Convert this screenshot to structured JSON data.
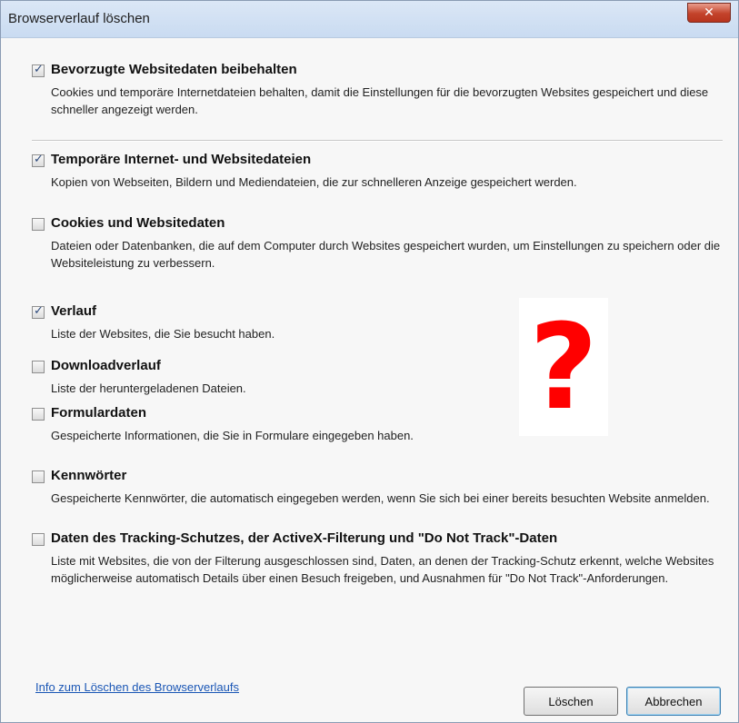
{
  "window": {
    "title": "Browserverlauf löschen",
    "close_icon": "close-icon",
    "close_glyph": "✕"
  },
  "options": [
    {
      "title": "Bevorzugte Websitedaten beibehalten",
      "desc": "Cookies und temporäre Internetdateien behalten, damit die Einstellungen für die bevorzugten Websites gespeichert und diese schneller angezeigt werden.",
      "checked": true
    },
    {
      "title": "Temporäre Internet- und Websitedateien",
      "desc": "Kopien von Webseiten, Bildern und Mediendateien, die zur schnelleren Anzeige gespeichert werden.",
      "checked": true
    },
    {
      "title": "Cookies und Websitedaten",
      "desc": "Dateien oder Datenbanken, die auf dem Computer durch Websites gespeichert wurden, um Einstellungen zu speichern oder die Websiteleistung zu verbessern.",
      "checked": false
    },
    {
      "title": "Verlauf",
      "desc": "Liste der Websites, die Sie besucht haben.",
      "checked": true
    },
    {
      "title": "Downloadverlauf",
      "desc": "Liste der heruntergeladenen Dateien.",
      "checked": false
    },
    {
      "title": "Formulardaten",
      "desc": "Gespeicherte Informationen, die Sie in Formulare eingegeben haben.",
      "checked": false
    },
    {
      "title": "Kennwörter",
      "desc": "Gespeicherte Kennwörter, die automatisch eingegeben werden, wenn Sie sich bei einer bereits besuchten Website anmelden.",
      "checked": false
    },
    {
      "title": "Daten des Tracking-Schutzes, der ActiveX-Filterung und \"Do Not Track\"-Daten",
      "desc": "Liste mit Websites, die von der Filterung ausgeschlossen sind, Daten, an denen der Tracking-Schutz erkennt, welche Websites möglicherweise automatisch Details über einen Besuch freigeben, und Ausnahmen für \"Do Not Track\"-Anforderungen.",
      "checked": false
    }
  ],
  "overlay": {
    "glyph": "?",
    "color": "#ff0000"
  },
  "footer": {
    "info_link": "Info zum Löschen des Browserverlaufs",
    "delete_label": "Löschen",
    "cancel_label": "Abbrechen"
  }
}
